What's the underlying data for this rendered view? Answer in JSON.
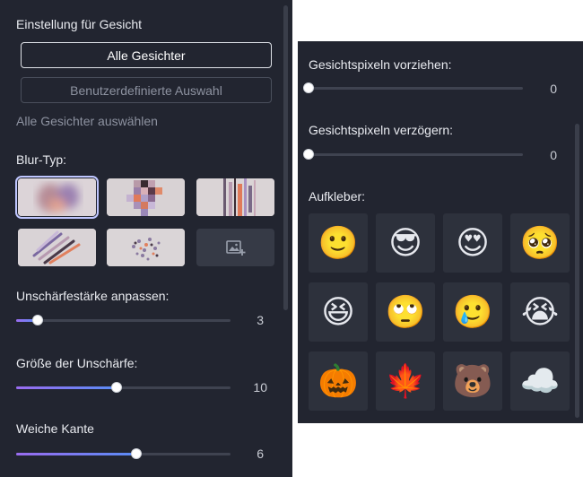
{
  "left": {
    "face_settings_title": "Einstellung für Gesicht",
    "all_faces_button": "Alle Gesichter",
    "custom_selection_button": "Benutzerdefinierte Auswahl",
    "select_all_faces_link": "Alle Gesichter auswählen",
    "blur_type_title": "Blur-Typ:",
    "blur_types": [
      {
        "name": "soft-blur",
        "selected": true
      },
      {
        "name": "pixelate",
        "selected": false
      },
      {
        "name": "glitch",
        "selected": false
      },
      {
        "name": "motion-smear",
        "selected": false
      },
      {
        "name": "noise-scatter",
        "selected": false
      }
    ],
    "sliders": [
      {
        "label": "Unschärfestärke anpassen:",
        "value": "3",
        "fraction": 0.1
      },
      {
        "label": "Größe der Unschärfe:",
        "value": "10",
        "fraction": 0.47
      },
      {
        "label": "Weiche Kante",
        "value": "6",
        "fraction": 0.56
      }
    ]
  },
  "right": {
    "sliders": [
      {
        "label": "Gesichtspixeln vorziehen:",
        "value": "0",
        "fraction": 0
      },
      {
        "label": "Gesichtspixeln verzögern:",
        "value": "0",
        "fraction": 0
      }
    ],
    "stickers_title": "Aufkleber:",
    "stickers": [
      {
        "name": "slight-smile",
        "glyph": "🙂"
      },
      {
        "name": "sunglasses",
        "glyph": "😎"
      },
      {
        "name": "heart-eyes",
        "glyph": "😍"
      },
      {
        "name": "pleading",
        "glyph": "🥺"
      },
      {
        "name": "laughing",
        "glyph": "😆"
      },
      {
        "name": "eye-roll",
        "glyph": "🙄"
      },
      {
        "name": "tearful-smile",
        "glyph": "🥲"
      },
      {
        "name": "loudly-crying",
        "glyph": "😭"
      },
      {
        "name": "pumpkin",
        "glyph": "🎃"
      },
      {
        "name": "maple-leaf",
        "glyph": "🍁"
      },
      {
        "name": "bear",
        "glyph": "🐻"
      },
      {
        "name": "cloud",
        "glyph": "☁️"
      }
    ]
  },
  "colors": {
    "panel": "#222530",
    "tile": "#2d313c",
    "accent_start": "#9a6cf0",
    "accent_end": "#5a8cf5"
  }
}
